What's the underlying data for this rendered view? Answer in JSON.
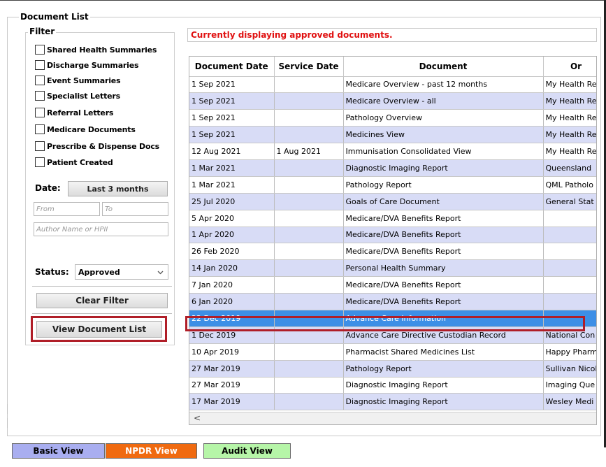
{
  "document_list": {
    "title": "Document List",
    "filter": {
      "title": "Filter",
      "checkboxes": [
        {
          "label": "Shared Health Summaries",
          "checked": false
        },
        {
          "label": "Discharge Summaries",
          "checked": false
        },
        {
          "label": "Event Summaries",
          "checked": false
        },
        {
          "label": "Specialist Letters",
          "checked": false
        },
        {
          "label": "Referral Letters",
          "checked": false
        },
        {
          "label": "Medicare Documents",
          "checked": false
        },
        {
          "label": "Prescribe & Dispense Docs",
          "checked": false
        },
        {
          "label": "Patient Created",
          "checked": false
        }
      ],
      "date_label": "Date:",
      "date_range_button": "Last 3 months",
      "from_placeholder": "From",
      "to_placeholder": "To",
      "author_placeholder": "Author Name or HPII",
      "status_label": "Status:",
      "status_value": "Approved",
      "clear_button": "Clear Filter",
      "view_list_button": "View Document List"
    },
    "banner": "Currently displaying approved documents.",
    "table": {
      "columns": [
        "Document Date",
        "Service Date",
        "Document",
        "Or"
      ],
      "rows": [
        {
          "doc_date": "1 Sep 2021",
          "service_date": "",
          "document": "Medicare Overview - past 12 months",
          "org": "My Health Re"
        },
        {
          "doc_date": "1 Sep 2021",
          "service_date": "",
          "document": "Medicare Overview - all",
          "org": "My Health Re"
        },
        {
          "doc_date": "1 Sep 2021",
          "service_date": "",
          "document": "Pathology Overview",
          "org": "My Health Re"
        },
        {
          "doc_date": "1 Sep 2021",
          "service_date": "",
          "document": "Medicines View",
          "org": "My Health Re"
        },
        {
          "doc_date": "12 Aug 2021",
          "service_date": "1 Aug 2021",
          "document": "Immunisation Consolidated View",
          "org": "My Health Re"
        },
        {
          "doc_date": "1 Mar 2021",
          "service_date": "",
          "document": "Diagnostic Imaging Report",
          "org": "Queensland"
        },
        {
          "doc_date": "1 Mar 2021",
          "service_date": "",
          "document": "Pathology Report",
          "org": "QML Patholo"
        },
        {
          "doc_date": "25 Jul 2020",
          "service_date": "",
          "document": "Goals of Care Document",
          "org": "General Stat"
        },
        {
          "doc_date": "5 Apr 2020",
          "service_date": "",
          "document": "Medicare/DVA Benefits Report",
          "org": ""
        },
        {
          "doc_date": "1 Apr 2020",
          "service_date": "",
          "document": "Medicare/DVA Benefits Report",
          "org": ""
        },
        {
          "doc_date": "26 Feb 2020",
          "service_date": "",
          "document": "Medicare/DVA Benefits Report",
          "org": ""
        },
        {
          "doc_date": "14 Jan 2020",
          "service_date": "",
          "document": "Personal Health Summary",
          "org": ""
        },
        {
          "doc_date": "7 Jan 2020",
          "service_date": "",
          "document": "Medicare/DVA Benefits Report",
          "org": ""
        },
        {
          "doc_date": "6 Jan 2020",
          "service_date": "",
          "document": "Medicare/DVA Benefits Report",
          "org": ""
        },
        {
          "doc_date": "22 Dec 2019",
          "service_date": "",
          "document": "Advance Care Information",
          "org": ""
        },
        {
          "doc_date": "1 Dec 2019",
          "service_date": "",
          "document": "Advance Care Directive Custodian Record",
          "org": "National Con"
        },
        {
          "doc_date": "10 Apr 2019",
          "service_date": "",
          "document": "Pharmacist Shared Medicines List",
          "org": "Happy Pharm"
        },
        {
          "doc_date": "27 Mar 2019",
          "service_date": "",
          "document": "Pathology Report",
          "org": "Sullivan Nicol"
        },
        {
          "doc_date": "27 Mar 2019",
          "service_date": "",
          "document": "Diagnostic Imaging Report",
          "org": "Imaging Que"
        },
        {
          "doc_date": "17 Mar 2019",
          "service_date": "",
          "document": "Diagnostic Imaging Report",
          "org": "Wesley Medi"
        }
      ],
      "selected_row_index": 14
    },
    "scroll_left_arrow": "<"
  },
  "view_buttons": {
    "basic": "Basic View",
    "npdr": "NPDR View",
    "audit": "Audit View"
  },
  "colors": {
    "banner_text": "#e01010",
    "row_alt": "#d8dcf6",
    "row_selected": "#3d8fe6",
    "highlight_outline": "#b01e28",
    "basic_view_bg": "#a9aef0",
    "npdr_view_bg": "#f06a10",
    "audit_view_bg": "#b6f5a8"
  },
  "icons": {
    "status_dropdown": "chevron-down-icon",
    "scroll_left": "chevron-left-icon"
  }
}
